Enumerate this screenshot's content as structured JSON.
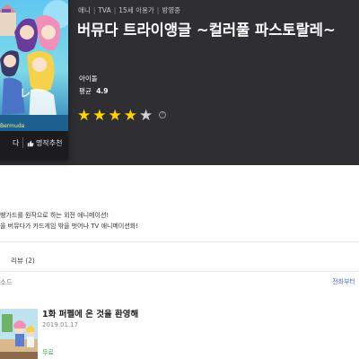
{
  "header": {
    "meta": [
      "애니",
      "TVA",
      "15세 이용가",
      "방영중"
    ],
    "title": "버뮤다 트라이앵글 ~컬러풀 파스토랄레~",
    "genre": "아이돌",
    "rating_label": "평균",
    "rating_value": "4.9",
    "stars": 5,
    "stars_filled": 4
  },
  "poster": {
    "left_action": "다",
    "recommend_label": "명작추천",
    "recommend_icon": "thumbs-up-icon"
  },
  "description": {
    "lines": [
      "뱅가드를 원작으로 하는 외전 애니메이션!",
      "을 버뮤다가 카드게임 밖을 벗어나 TV 애니메이션화!"
    ]
  },
  "tabs": {
    "review_label": "리뷰",
    "review_count": "(2)"
  },
  "episodes": {
    "section_label": "소드",
    "view_all": "전화부터",
    "items": [
      {
        "title": "1화 퍼펠에 온 것을 환영해",
        "date": "2019.01.17",
        "price": "무료"
      }
    ]
  },
  "colors": {
    "hero_bg": "#2f2f33",
    "star_on": "#ffd400",
    "star_off": "#cfcfcf",
    "link": "#4a6fd8",
    "free": "#3ba55c"
  }
}
